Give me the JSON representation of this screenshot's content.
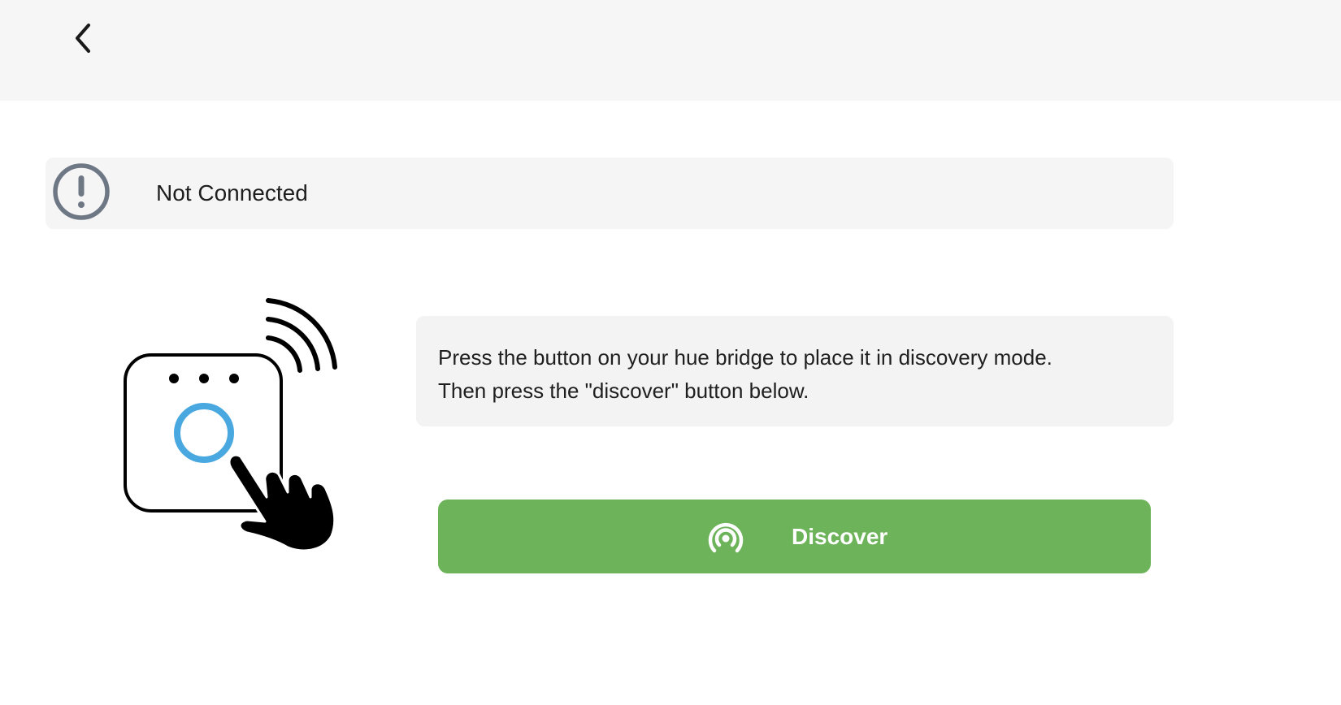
{
  "header": {
    "back_icon": "chevron-left-icon"
  },
  "status": {
    "icon": "exclamation-circle-icon",
    "text": "Not Connected",
    "icon_color": "#6e7784"
  },
  "illustration": {
    "icon": "hue-bridge-press-icon",
    "ring_color": "#4aa8e0"
  },
  "instructions": {
    "line1": "Press the button on your hue bridge to place it in discovery mode.",
    "line2": "Then press the \"discover\" button below."
  },
  "discover_button": {
    "label": "Discover",
    "icon": "broadcast-icon",
    "color": "#6db35a"
  }
}
